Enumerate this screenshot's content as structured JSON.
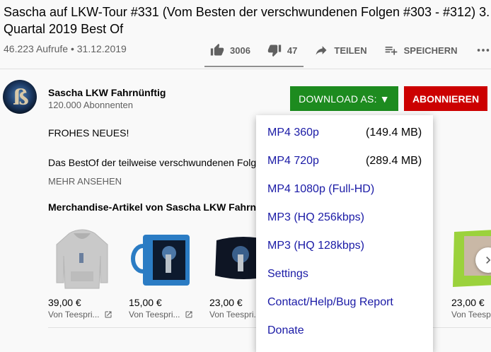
{
  "video": {
    "title": "Sascha auf LKW-Tour #331 (Vom Besten der verschwundenen Folgen #303 - #312) 3. Quartal 2019 Best Of",
    "views_date": "46.223 Aufrufe • 31.12.2019"
  },
  "actions": {
    "like_count": "3006",
    "dislike_count": "47",
    "share_label": "TEILEN",
    "save_label": "SPEICHERN"
  },
  "channel": {
    "name": "Sascha LKW Fahrnünftig",
    "subscribers": "120.000 Abonnenten",
    "download_label": "DOWNLOAD AS: ▼",
    "subscribe_label": "ABONNIEREN"
  },
  "description": {
    "line1": "FROHES NEUES!",
    "line2": "Das BestOf der teilweise verschwundenen Folgen",
    "more_label": "MEHR ANSEHEN"
  },
  "merch": {
    "title": "Merchandise-Artikel von Sascha LKW Fahrnünftig",
    "items": [
      {
        "price": "39,00 €",
        "vendor": "Von Teespri..."
      },
      {
        "price": "15,00 €",
        "vendor": "Von Teespri..."
      },
      {
        "price": "23,00 €",
        "vendor": "Von Teespri..."
      },
      {
        "price": "23,00 €",
        "vendor": "Von Teespri..."
      }
    ]
  },
  "download_menu": {
    "items": [
      {
        "label": "MP4 360p",
        "size": "(149.4 MB)"
      },
      {
        "label": "MP4 720p",
        "size": "(289.4 MB)"
      },
      {
        "label": "MP4 1080p (Full-HD)",
        "size": ""
      },
      {
        "label": "MP3 (HQ 256kbps)",
        "size": ""
      },
      {
        "label": "MP3 (HQ 128kbps)",
        "size": ""
      },
      {
        "label": "Settings",
        "size": ""
      },
      {
        "label": "Contact/Help/Bug Report",
        "size": ""
      },
      {
        "label": "Donate",
        "size": ""
      }
    ]
  },
  "colors": {
    "download_green": "#1d8b1f",
    "subscribe_red": "#cc0000",
    "menu_link": "#1a1aa6"
  }
}
